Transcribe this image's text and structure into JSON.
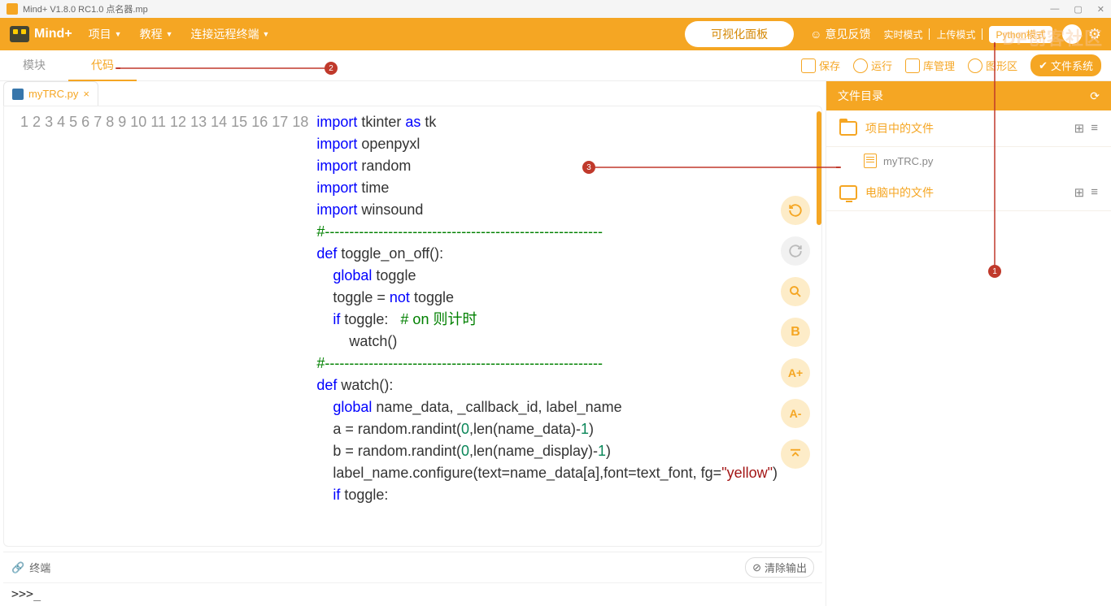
{
  "title": "Mind+ V1.8.0 RC1.0   点名器.mp",
  "brand": "Mind+",
  "menus": {
    "project": "项目",
    "tutorial": "教程",
    "remote": "连接远程终端"
  },
  "vis_panel": "可视化面板",
  "feedback": "意见反馈",
  "modes": {
    "realtime": "实时模式",
    "upload": "上传模式",
    "python": "Python模式"
  },
  "toolbar": {
    "tab_module": "模块",
    "tab_code": "代码",
    "save": "保存",
    "run": "运行",
    "lib": "库管理",
    "graphic": "图形区",
    "filesys": "文件系统"
  },
  "open_file": "myTRC.py",
  "terminal_label": "终端",
  "clear_output": "清除输出",
  "repl_prompt": ">>>_",
  "sidebar": {
    "header": "文件目录",
    "project_files": "项目中的文件",
    "computer_files": "电脑中的文件",
    "file": "myTRC.py"
  },
  "sidebuttons": {
    "bold": "B",
    "aplus": "A+",
    "aminus": "A-"
  },
  "annotations": {
    "a1": "1",
    "a2": "2",
    "a3": "3"
  },
  "watermark": "DF创客社区",
  "code": {
    "l1": {
      "a": "import",
      "b": " tkinter ",
      "c": "as",
      "d": " tk"
    },
    "l2": {
      "a": "import",
      "b": " openpyxl"
    },
    "l3": {
      "a": "import",
      "b": " random"
    },
    "l4": {
      "a": "import",
      "b": " time"
    },
    "l5": {
      "a": "import",
      "b": " winsound"
    },
    "dash": "#---------------------------------------------------------",
    "l7": {
      "a": "def",
      "b": " toggle_on_off():"
    },
    "l8": {
      "a": "    ",
      "b": "global",
      "c": " toggle"
    },
    "l9": "    toggle = ",
    "l9b": "not",
    "l9c": " toggle",
    "l10a": "    ",
    "l10b": "if",
    "l10c": " toggle:   ",
    "l10d": "# on 则计时",
    "l11": "        watch()",
    "l13": {
      "a": "def",
      "b": " watch():"
    },
    "l14a": "    ",
    "l14b": "global",
    "l14c": " name_data, _callback_id, label_name",
    "l15a": "    a = random.randint(",
    "l15b": "0",
    "l15c": ",len(name_data)-",
    "l15d": "1",
    "l15e": ")",
    "l16a": "    b = random.randint(",
    "l16b": "0",
    "l16c": ",len(name_display)-",
    "l16d": "1",
    "l16e": ")",
    "l17a": "    label_name.configure(text=name_data[a],font=text_font, fg=",
    "l17b": "\"yellow\"",
    "l17c": ")",
    "l18a": "    ",
    "l18b": "if",
    "l18c": " toggle:"
  },
  "linenums": [
    "1",
    "2",
    "3",
    "4",
    "5",
    "6",
    "7",
    "8",
    "9",
    "10",
    "11",
    "12",
    "13",
    "14",
    "15",
    "16",
    "17",
    "18"
  ]
}
